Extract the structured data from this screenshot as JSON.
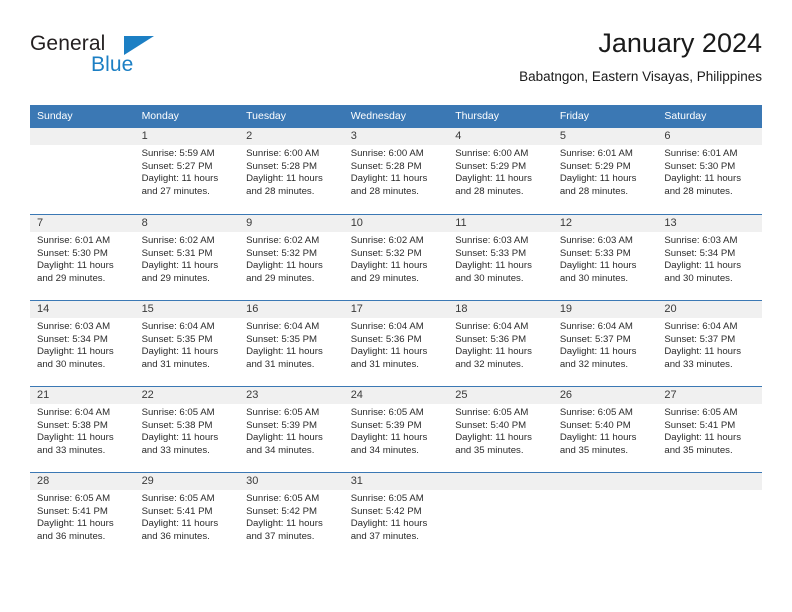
{
  "brand": {
    "name_part1": "General",
    "name_part2": "Blue",
    "accent_color": "#1c7fc4"
  },
  "header": {
    "title": "January 2024",
    "subtitle": "Babatngon, Eastern Visayas, Philippines"
  },
  "theme": {
    "header_row_bg": "#3b78b4",
    "daynum_bg": "#f0f0f0",
    "grid_line": "#3b78b4"
  },
  "weekdays": [
    "Sunday",
    "Monday",
    "Tuesday",
    "Wednesday",
    "Thursday",
    "Friday",
    "Saturday"
  ],
  "weeks": [
    [
      {
        "day": "",
        "sunrise": "",
        "sunset": "",
        "daylight": ""
      },
      {
        "day": "1",
        "sunrise": "Sunrise: 5:59 AM",
        "sunset": "Sunset: 5:27 PM",
        "daylight": "Daylight: 11 hours and 27 minutes."
      },
      {
        "day": "2",
        "sunrise": "Sunrise: 6:00 AM",
        "sunset": "Sunset: 5:28 PM",
        "daylight": "Daylight: 11 hours and 28 minutes."
      },
      {
        "day": "3",
        "sunrise": "Sunrise: 6:00 AM",
        "sunset": "Sunset: 5:28 PM",
        "daylight": "Daylight: 11 hours and 28 minutes."
      },
      {
        "day": "4",
        "sunrise": "Sunrise: 6:00 AM",
        "sunset": "Sunset: 5:29 PM",
        "daylight": "Daylight: 11 hours and 28 minutes."
      },
      {
        "day": "5",
        "sunrise": "Sunrise: 6:01 AM",
        "sunset": "Sunset: 5:29 PM",
        "daylight": "Daylight: 11 hours and 28 minutes."
      },
      {
        "day": "6",
        "sunrise": "Sunrise: 6:01 AM",
        "sunset": "Sunset: 5:30 PM",
        "daylight": "Daylight: 11 hours and 28 minutes."
      }
    ],
    [
      {
        "day": "7",
        "sunrise": "Sunrise: 6:01 AM",
        "sunset": "Sunset: 5:30 PM",
        "daylight": "Daylight: 11 hours and 29 minutes."
      },
      {
        "day": "8",
        "sunrise": "Sunrise: 6:02 AM",
        "sunset": "Sunset: 5:31 PM",
        "daylight": "Daylight: 11 hours and 29 minutes."
      },
      {
        "day": "9",
        "sunrise": "Sunrise: 6:02 AM",
        "sunset": "Sunset: 5:32 PM",
        "daylight": "Daylight: 11 hours and 29 minutes."
      },
      {
        "day": "10",
        "sunrise": "Sunrise: 6:02 AM",
        "sunset": "Sunset: 5:32 PM",
        "daylight": "Daylight: 11 hours and 29 minutes."
      },
      {
        "day": "11",
        "sunrise": "Sunrise: 6:03 AM",
        "sunset": "Sunset: 5:33 PM",
        "daylight": "Daylight: 11 hours and 30 minutes."
      },
      {
        "day": "12",
        "sunrise": "Sunrise: 6:03 AM",
        "sunset": "Sunset: 5:33 PM",
        "daylight": "Daylight: 11 hours and 30 minutes."
      },
      {
        "day": "13",
        "sunrise": "Sunrise: 6:03 AM",
        "sunset": "Sunset: 5:34 PM",
        "daylight": "Daylight: 11 hours and 30 minutes."
      }
    ],
    [
      {
        "day": "14",
        "sunrise": "Sunrise: 6:03 AM",
        "sunset": "Sunset: 5:34 PM",
        "daylight": "Daylight: 11 hours and 30 minutes."
      },
      {
        "day": "15",
        "sunrise": "Sunrise: 6:04 AM",
        "sunset": "Sunset: 5:35 PM",
        "daylight": "Daylight: 11 hours and 31 minutes."
      },
      {
        "day": "16",
        "sunrise": "Sunrise: 6:04 AM",
        "sunset": "Sunset: 5:35 PM",
        "daylight": "Daylight: 11 hours and 31 minutes."
      },
      {
        "day": "17",
        "sunrise": "Sunrise: 6:04 AM",
        "sunset": "Sunset: 5:36 PM",
        "daylight": "Daylight: 11 hours and 31 minutes."
      },
      {
        "day": "18",
        "sunrise": "Sunrise: 6:04 AM",
        "sunset": "Sunset: 5:36 PM",
        "daylight": "Daylight: 11 hours and 32 minutes."
      },
      {
        "day": "19",
        "sunrise": "Sunrise: 6:04 AM",
        "sunset": "Sunset: 5:37 PM",
        "daylight": "Daylight: 11 hours and 32 minutes."
      },
      {
        "day": "20",
        "sunrise": "Sunrise: 6:04 AM",
        "sunset": "Sunset: 5:37 PM",
        "daylight": "Daylight: 11 hours and 33 minutes."
      }
    ],
    [
      {
        "day": "21",
        "sunrise": "Sunrise: 6:04 AM",
        "sunset": "Sunset: 5:38 PM",
        "daylight": "Daylight: 11 hours and 33 minutes."
      },
      {
        "day": "22",
        "sunrise": "Sunrise: 6:05 AM",
        "sunset": "Sunset: 5:38 PM",
        "daylight": "Daylight: 11 hours and 33 minutes."
      },
      {
        "day": "23",
        "sunrise": "Sunrise: 6:05 AM",
        "sunset": "Sunset: 5:39 PM",
        "daylight": "Daylight: 11 hours and 34 minutes."
      },
      {
        "day": "24",
        "sunrise": "Sunrise: 6:05 AM",
        "sunset": "Sunset: 5:39 PM",
        "daylight": "Daylight: 11 hours and 34 minutes."
      },
      {
        "day": "25",
        "sunrise": "Sunrise: 6:05 AM",
        "sunset": "Sunset: 5:40 PM",
        "daylight": "Daylight: 11 hours and 35 minutes."
      },
      {
        "day": "26",
        "sunrise": "Sunrise: 6:05 AM",
        "sunset": "Sunset: 5:40 PM",
        "daylight": "Daylight: 11 hours and 35 minutes."
      },
      {
        "day": "27",
        "sunrise": "Sunrise: 6:05 AM",
        "sunset": "Sunset: 5:41 PM",
        "daylight": "Daylight: 11 hours and 35 minutes."
      }
    ],
    [
      {
        "day": "28",
        "sunrise": "Sunrise: 6:05 AM",
        "sunset": "Sunset: 5:41 PM",
        "daylight": "Daylight: 11 hours and 36 minutes."
      },
      {
        "day": "29",
        "sunrise": "Sunrise: 6:05 AM",
        "sunset": "Sunset: 5:41 PM",
        "daylight": "Daylight: 11 hours and 36 minutes."
      },
      {
        "day": "30",
        "sunrise": "Sunrise: 6:05 AM",
        "sunset": "Sunset: 5:42 PM",
        "daylight": "Daylight: 11 hours and 37 minutes."
      },
      {
        "day": "31",
        "sunrise": "Sunrise: 6:05 AM",
        "sunset": "Sunset: 5:42 PM",
        "daylight": "Daylight: 11 hours and 37 minutes."
      },
      {
        "day": "",
        "sunrise": "",
        "sunset": "",
        "daylight": ""
      },
      {
        "day": "",
        "sunrise": "",
        "sunset": "",
        "daylight": ""
      },
      {
        "day": "",
        "sunrise": "",
        "sunset": "",
        "daylight": ""
      }
    ]
  ]
}
